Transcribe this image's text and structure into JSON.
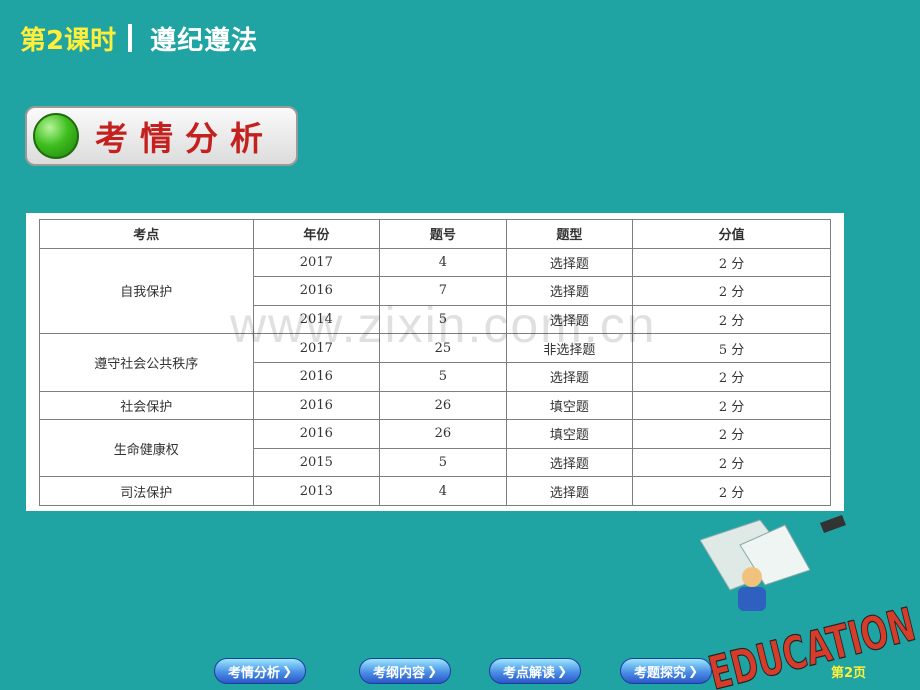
{
  "header": {
    "lesson": "第2课时",
    "subject": "遵纪遵法"
  },
  "section": {
    "title": "考情分析"
  },
  "watermark": "www.zixin.com.cn",
  "table": {
    "headers": [
      "考点",
      "年份",
      "题号",
      "题型",
      "分值"
    ],
    "groups": [
      {
        "topic": "自我保护",
        "rows": [
          {
            "year": "2017",
            "number": "4",
            "type": "选择题",
            "score": "2 分"
          },
          {
            "year": "2016",
            "number": "7",
            "type": "选择题",
            "score": "2 分"
          },
          {
            "year": "2014",
            "number": "5",
            "type": "选择题",
            "score": "2 分"
          }
        ]
      },
      {
        "topic": "遵守社会公共秩序",
        "rows": [
          {
            "year": "2017",
            "number": "25",
            "type": "非选择题",
            "score": "5 分"
          },
          {
            "year": "2016",
            "number": "5",
            "type": "选择题",
            "score": "2 分"
          }
        ]
      },
      {
        "topic": "社会保护",
        "rows": [
          {
            "year": "2016",
            "number": "26",
            "type": "填空题",
            "score": "2 分"
          }
        ]
      },
      {
        "topic": "生命健康权",
        "rows": [
          {
            "year": "2016",
            "number": "26",
            "type": "填空题",
            "score": "2 分"
          },
          {
            "year": "2015",
            "number": "5",
            "type": "选择题",
            "score": "2 分"
          }
        ]
      },
      {
        "topic": "司法保护",
        "rows": [
          {
            "year": "2013",
            "number": "4",
            "type": "选择题",
            "score": "2 分"
          }
        ]
      }
    ]
  },
  "nav": {
    "buttons": [
      "考情分析",
      "考纲内容",
      "考点解读",
      "考题探究"
    ],
    "page": "第2页"
  },
  "illustration": {
    "word": "EDUCATION"
  }
}
